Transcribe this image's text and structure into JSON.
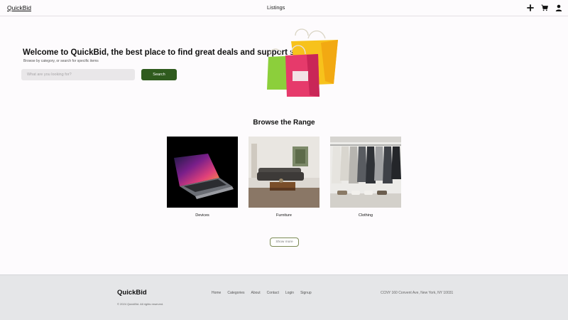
{
  "header": {
    "brand": "QuickBid",
    "nav_listings": "Listings",
    "icons": [
      "plus-icon",
      "cart-icon",
      "user-icon"
    ]
  },
  "hero": {
    "title": "Welcome to QuickBid, the best place to find great deals and support sellers!",
    "subtitle": "Browse by category, or search for specific items",
    "search_placeholder": "What are you looking for?",
    "search_button": "Search",
    "image": "shopping-bags"
  },
  "browse": {
    "title": "Browse the Range",
    "categories": [
      {
        "label": "Devices",
        "image": "laptop"
      },
      {
        "label": "Furniture",
        "image": "living-room"
      },
      {
        "label": "Clothing",
        "image": "clothes-rack"
      }
    ],
    "show_more": "Show more"
  },
  "footer": {
    "brand": "QuickBid",
    "links": [
      "Home",
      "Categories",
      "About",
      "Contact",
      "Login",
      "Signup"
    ],
    "address": "CCNY 160 Convent Ave, New York, NY 10031",
    "copyright": "© 2024 QuickBid. All rights reserved."
  },
  "colors": {
    "accent": "#2f5b1e",
    "background": "#fdfbfd",
    "footer_bg": "#e5e6e8",
    "show_more_border": "#7c8a55"
  }
}
